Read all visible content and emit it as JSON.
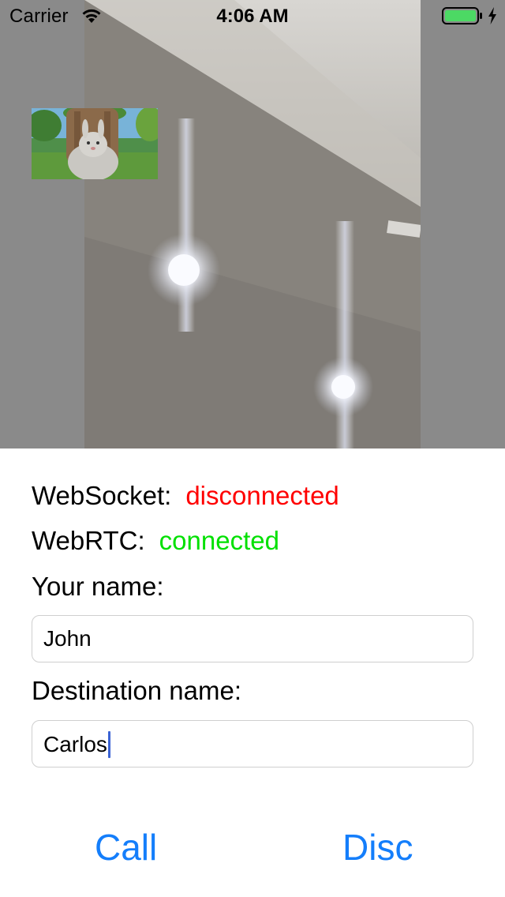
{
  "status_bar": {
    "carrier": "Carrier",
    "time": "4:06 AM",
    "battery_color": "#4cd964",
    "wifi_icon": "wifi-icon",
    "battery_icon": "battery-icon",
    "charging_icon": "charging-bolt-icon"
  },
  "video": {
    "remote_label": "remote-video-feed",
    "local_label": "local-video-preview"
  },
  "status": {
    "websocket_label": "WebSocket:",
    "websocket_value": "disconnected",
    "websocket_color": "#ff0000",
    "webrtc_label": "WebRTC:",
    "webrtc_value": "connected",
    "webrtc_color": "#00e000"
  },
  "form": {
    "your_name_label": "Your name:",
    "your_name_value": "John",
    "destination_label": "Destination name:",
    "destination_value": "Carlos"
  },
  "actions": {
    "call_label": "Call",
    "disc_label": "Disc",
    "accent_color": "#147efb"
  }
}
